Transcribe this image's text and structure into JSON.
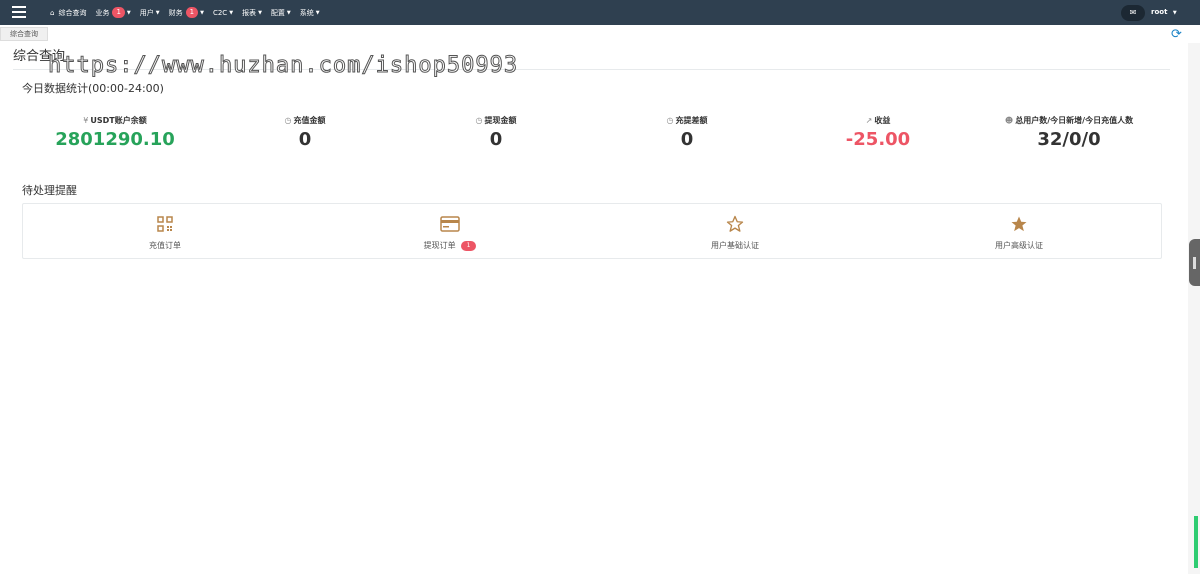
{
  "nav": {
    "items": [
      {
        "label": "综合查询",
        "icon": "home-icon"
      },
      {
        "label": "业务",
        "badge": "1"
      },
      {
        "label": "用户"
      },
      {
        "label": "财务",
        "badge": "1"
      },
      {
        "label": "C2C"
      },
      {
        "label": "报表"
      },
      {
        "label": "配置"
      },
      {
        "label": "系统"
      }
    ],
    "user": "root"
  },
  "tabs": {
    "active": "综合查询"
  },
  "page": {
    "title": "综合查询"
  },
  "watermark": "https://www.huzhan.com/ishop50993",
  "today": {
    "title": "今日数据统计(00:00-24:00)",
    "stats": [
      {
        "icon": "yen-icon",
        "label": "USDT账户余额",
        "value": "2801290.10",
        "color": "#27a35a"
      },
      {
        "icon": "clock-icon",
        "label": "充值金额",
        "value": "0",
        "color": "#333333"
      },
      {
        "icon": "clock-icon",
        "label": "提现金额",
        "value": "0",
        "color": "#333333"
      },
      {
        "icon": "clock-icon",
        "label": "充提差额",
        "value": "0",
        "color": "#333333"
      },
      {
        "icon": "chart-icon",
        "label": "收益",
        "value": "-25.00",
        "color": "#ed5565"
      },
      {
        "icon": "users-icon",
        "label": "总用户数/今日新增/今日充值人数",
        "value": "32/0/0",
        "color": "#333333"
      }
    ]
  },
  "pending": {
    "title": "待处理提醒",
    "items": [
      {
        "icon": "qrcode-icon",
        "label": "充值订单"
      },
      {
        "icon": "credit-card-icon",
        "label": "提现订单",
        "badge": "1"
      },
      {
        "icon": "star-outline-icon",
        "label": "用户基础认证"
      },
      {
        "icon": "star-filled-icon",
        "label": "用户高级认证"
      }
    ]
  },
  "colors": {
    "topbar": "#2f4050",
    "accent": "#b8864b",
    "badge": "#ed5565"
  }
}
